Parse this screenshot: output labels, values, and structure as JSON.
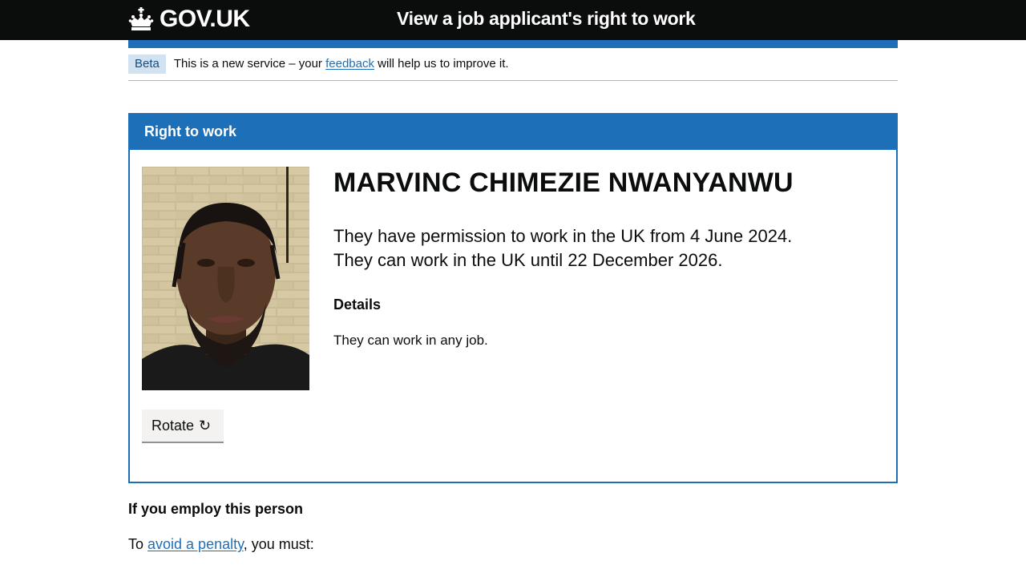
{
  "header": {
    "logo_text": "GOV.UK",
    "service_name": "View a job applicant's right to work"
  },
  "phase_banner": {
    "tag": "Beta",
    "text_before": "This is a new service – your ",
    "link": "feedback",
    "text_after": " will help us to improve it."
  },
  "panel": {
    "title": "Right to work",
    "name": "MARVINC CHIMEZIE NWANYANWU",
    "status_line_1": "They have permission to work in the UK from 4 June 2024.",
    "status_line_2": "They can work in the UK until 22 December 2026.",
    "details_heading": "Details",
    "details_text": "They can work in any job.",
    "rotate_label": "Rotate",
    "rotate_icon": "↻"
  },
  "employ": {
    "heading": "If you employ this person",
    "text_before": "To ",
    "link": "avoid a penalty",
    "text_after": ", you must:"
  },
  "colors": {
    "header_bg": "#0b0c0c",
    "brand_blue": "#1d70b8",
    "tag_bg": "#d2e2f1"
  }
}
